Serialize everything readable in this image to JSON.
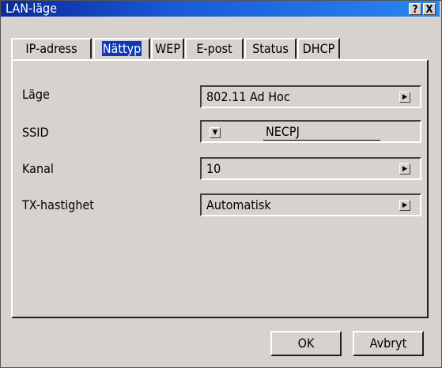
{
  "window": {
    "title": "LAN-läge",
    "help_label": "?",
    "close_label": "X"
  },
  "tabs": [
    {
      "label": "IP-adress",
      "active": false
    },
    {
      "label": "Nättyp",
      "active": true
    },
    {
      "label": "WEP",
      "active": false
    },
    {
      "label": "E-post",
      "active": false
    },
    {
      "label": "Status",
      "active": false
    },
    {
      "label": "DHCP",
      "active": false
    }
  ],
  "form": {
    "mode": {
      "label": "Läge",
      "value": "802.11 Ad Hoc"
    },
    "ssid": {
      "label": "SSID",
      "value": "NECPJ"
    },
    "channel": {
      "label": "Kanal",
      "value": "10"
    },
    "tx_rate": {
      "label": "TX-hastighet",
      "value": "Automatisk"
    }
  },
  "buttons": {
    "ok": "OK",
    "cancel": "Avbryt"
  },
  "icons": {
    "right_arrow": "right-arrow-icon",
    "dropdown": "down-arrow-icon"
  },
  "colors": {
    "title_bar": "#1a5ad8",
    "active_tab": "#1037b8",
    "face": "#d6d3ce"
  }
}
